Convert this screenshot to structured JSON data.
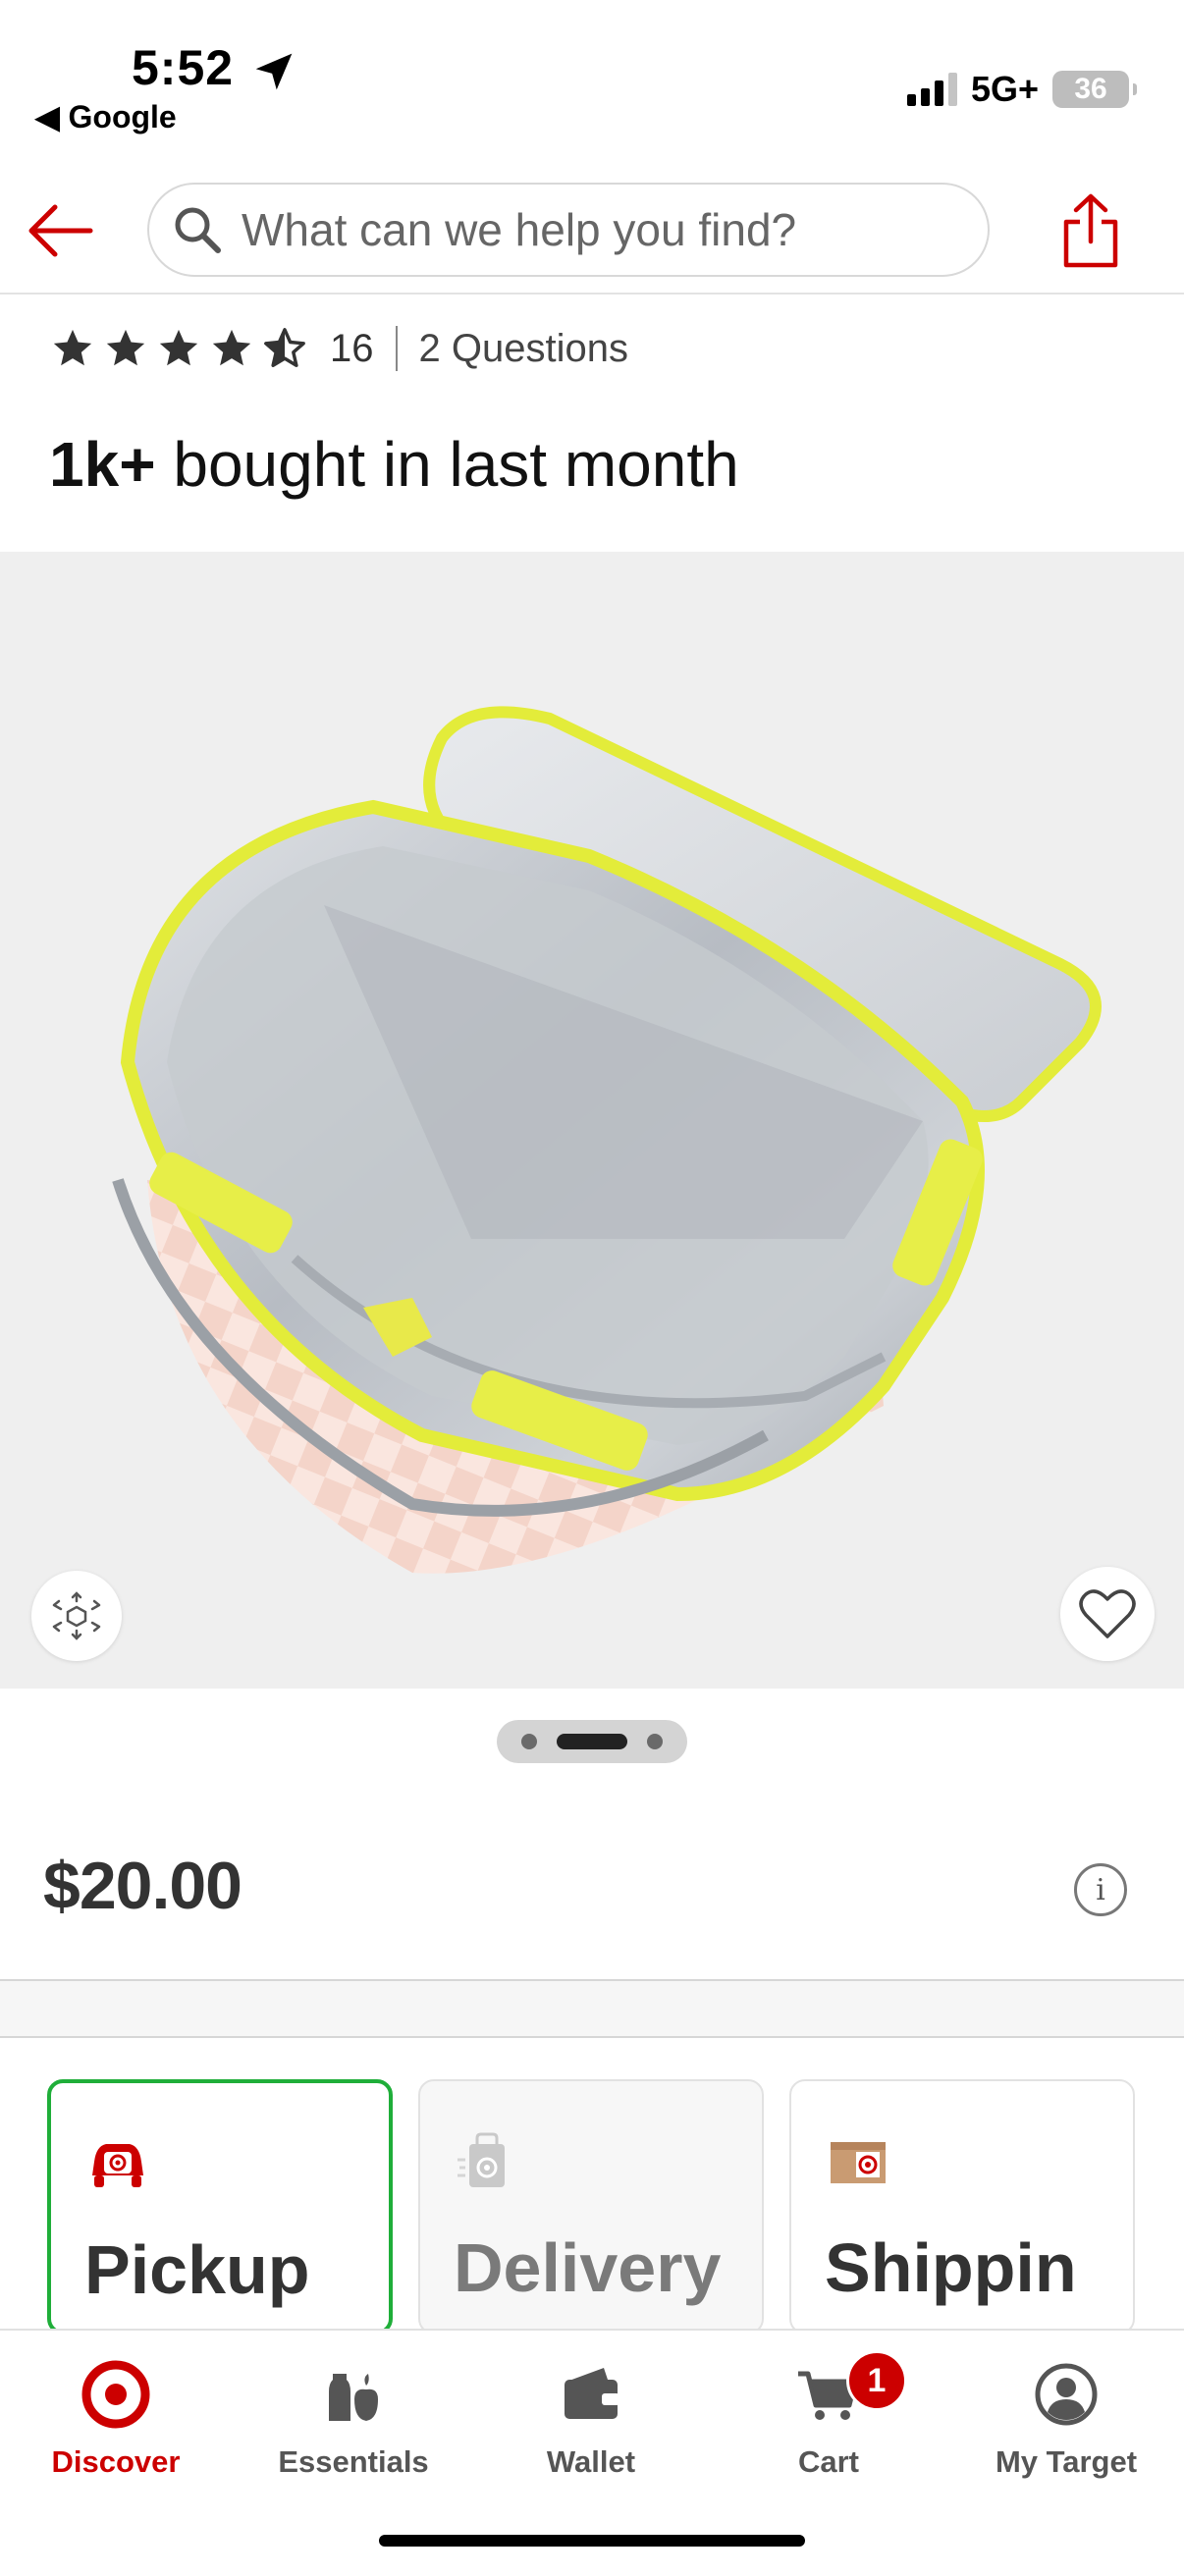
{
  "status_bar": {
    "time": "5:52",
    "back_app": "◀ Google",
    "network": "5G+",
    "battery": "36"
  },
  "header": {
    "search_placeholder": "What can we help you find?",
    "accent_color": "#cc0000"
  },
  "product": {
    "rating_value": 4.5,
    "rating_count": "16",
    "questions": "2 Questions",
    "bought_bold": "1k+",
    "bought_rest": " bought in last month",
    "image_index": 2,
    "image_count": 3,
    "price": "$20.00"
  },
  "fulfillment": {
    "pickup": "Pickup",
    "delivery": "Delivery",
    "shipping": "Shippin",
    "selected_color": "#1fae39"
  },
  "tabs": {
    "discover": "Discover",
    "essentials": "Essentials",
    "wallet": "Wallet",
    "cart": "Cart",
    "cart_badge": "1",
    "my_target": "My Target"
  }
}
